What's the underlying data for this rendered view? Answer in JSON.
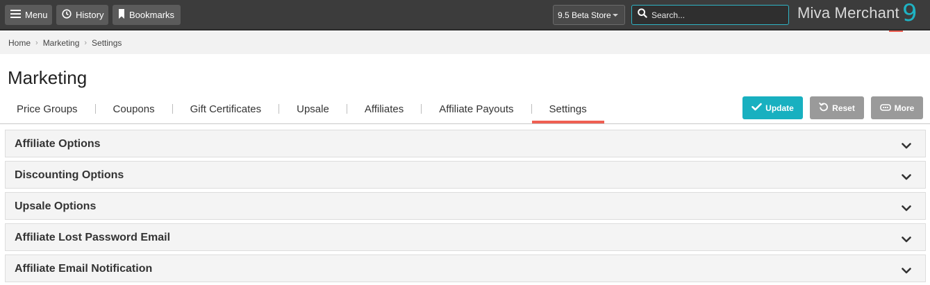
{
  "topbar": {
    "menu_label": "Menu",
    "history_label": "History",
    "bookmarks_label": "Bookmarks",
    "store_selected": "9.5 Beta Store",
    "search_placeholder": "Search...",
    "logo_text": "Miva Merchant",
    "logo_version": "9",
    "accent_color": "#1fb3c4",
    "ribbon_color": "#ef5f52"
  },
  "breadcrumb": {
    "items": [
      "Home",
      "Marketing",
      "Settings"
    ]
  },
  "page": {
    "title": "Marketing"
  },
  "tabs": [
    {
      "label": "Price Groups",
      "active": false
    },
    {
      "label": "Coupons",
      "active": false
    },
    {
      "label": "Gift Certificates",
      "active": false
    },
    {
      "label": "Upsale",
      "active": false
    },
    {
      "label": "Affiliates",
      "active": false
    },
    {
      "label": "Affiliate Payouts",
      "active": false
    },
    {
      "label": "Settings",
      "active": true
    }
  ],
  "actions": {
    "update_label": "Update",
    "reset_label": "Reset",
    "more_label": "More",
    "update_color": "#18b0c0",
    "secondary_color": "#9a9a9a"
  },
  "panels": [
    {
      "title": "Affiliate Options",
      "icon": "chevron-down-icon"
    },
    {
      "title": "Discounting Options",
      "icon": "chevron-down-icon"
    },
    {
      "title": "Upsale Options",
      "icon": "chevron-down-icon"
    },
    {
      "title": "Affiliate Lost Password Email",
      "icon": "chevron-down-icon"
    },
    {
      "title": "Affiliate Email Notification",
      "icon": "chevron-down-icon"
    }
  ]
}
